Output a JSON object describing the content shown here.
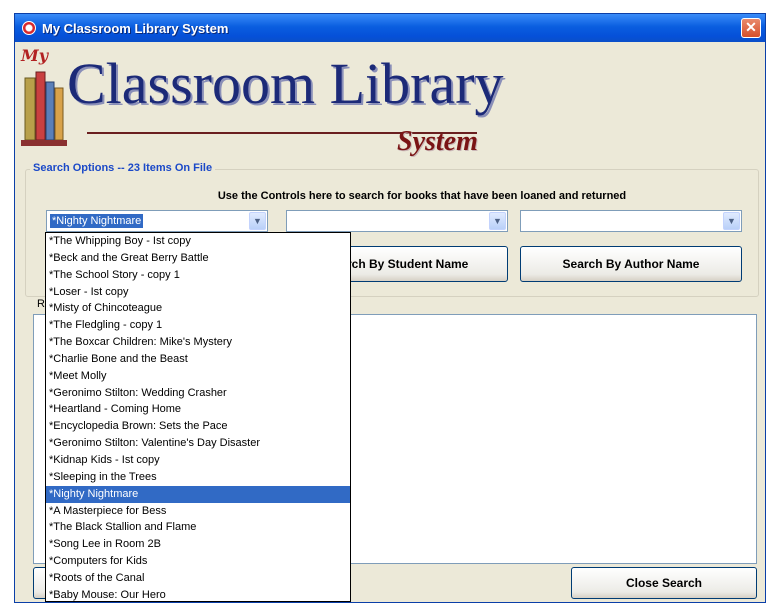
{
  "window": {
    "title": "My Classroom Library System",
    "close_glyph": "✕"
  },
  "logo": {
    "my": "My",
    "main": "Classroom Library",
    "sub": "System"
  },
  "search": {
    "legend": "Search Options  --  23 Items On File",
    "instructions": "Use the Controls here to search for books that have been loaned and returned",
    "combo1_value": "*Nighty Nightmare",
    "combo2_value": "",
    "combo3_value": "",
    "arrow_glyph": "▼",
    "student_button": "Search By Student Name",
    "author_button": "Search By Author Name"
  },
  "results": {
    "label": "R"
  },
  "footer": {
    "close_button": "Close Search"
  },
  "dropdown": {
    "items": [
      "*The Whipping Boy - Ist copy",
      "*Beck and the Great Berry Battle",
      "*The School Story - copy 1",
      "*Loser - Ist copy",
      "*Misty of Chincoteague",
      "*The Fledgling - copy 1",
      "*The Boxcar Children:  Mike's Mystery",
      "*Charlie Bone and the Beast",
      "*Meet Molly",
      "*Geronimo Stilton: Wedding Crasher",
      "*Heartland - Coming Home",
      "*Encyclopedia Brown: Sets the Pace",
      "*Geronimo Stilton: Valentine's Day Disaster",
      "*Kidnap Kids - Ist copy",
      "*Sleeping in the Trees",
      "*Nighty Nightmare",
      "*A Masterpiece for Bess",
      "*The Black Stallion and Flame",
      "*Song Lee in Room 2B",
      "*Computers for Kids",
      "*Roots of the Canal",
      "*Baby Mouse: Our Hero"
    ],
    "selected_index": 15
  },
  "colors": {
    "accent": "#316ac5",
    "title_bar": "#0a5ee0",
    "logo_blue": "#1c2a78",
    "logo_red": "#7a1414"
  }
}
